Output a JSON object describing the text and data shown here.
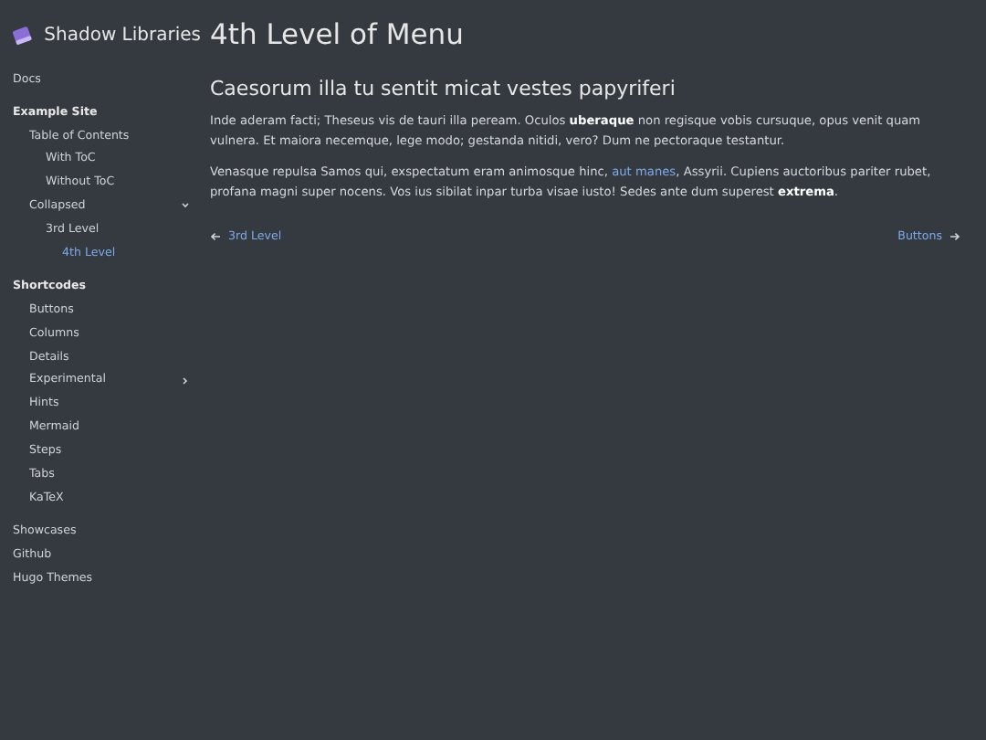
{
  "brand": {
    "title": "Shadow Libraries"
  },
  "sidebar": {
    "items": [
      {
        "label": "Docs",
        "kind": "link",
        "selected": false
      },
      {
        "label": "Example Site",
        "kind": "section",
        "selected": false,
        "children": [
          {
            "label": "Table of Contents",
            "kind": "link",
            "selected": false,
            "children": [
              {
                "label": "With ToC",
                "kind": "link",
                "selected": false
              },
              {
                "label": "Without ToC",
                "kind": "link",
                "selected": false
              }
            ]
          },
          {
            "label": "Collapsed",
            "kind": "collapsible",
            "expanded": true,
            "selected": false,
            "children": [
              {
                "label": "3rd Level",
                "kind": "link",
                "selected": false,
                "children": [
                  {
                    "label": "4th Level",
                    "kind": "link",
                    "selected": true
                  }
                ]
              }
            ]
          }
        ]
      },
      {
        "label": "Shortcodes",
        "kind": "section",
        "selected": false,
        "children": [
          {
            "label": "Buttons",
            "kind": "link",
            "selected": false
          },
          {
            "label": "Columns",
            "kind": "link",
            "selected": false
          },
          {
            "label": "Details",
            "kind": "link",
            "selected": false
          },
          {
            "label": "Experimental",
            "kind": "collapsible",
            "expanded": false,
            "selected": false
          },
          {
            "label": "Hints",
            "kind": "link",
            "selected": false
          },
          {
            "label": "Mermaid",
            "kind": "link",
            "selected": false
          },
          {
            "label": "Steps",
            "kind": "link",
            "selected": false
          },
          {
            "label": "Tabs",
            "kind": "link",
            "selected": false
          },
          {
            "label": "KaTeX",
            "kind": "link",
            "selected": false
          }
        ]
      },
      {
        "label": "Showcases",
        "kind": "link",
        "selected": false
      },
      {
        "label": "Github",
        "kind": "link",
        "selected": false
      },
      {
        "label": "Hugo Themes",
        "kind": "link",
        "selected": false
      }
    ]
  },
  "page": {
    "title": "4th Level of Menu",
    "heading": "Caesorum illa tu sentit micat vestes papyriferi",
    "paragraphs": [
      [
        {
          "kind": "text",
          "text": "Inde aderam facti; Theseus vis de tauri illa peream. Oculos **uberaque** non regisque vobis cursuque, opus venit quam vulnera. Et maiora necemque, lege modo; gestanda nitidi, vero? Dum ne pectoraque testantur."
        }
      ],
      [
        {
          "kind": "text",
          "text": "Venasque repulsa Samos qui, exspectatum eram animosque hinc, "
        },
        {
          "kind": "link",
          "text": "aut manes"
        },
        {
          "kind": "text",
          "text": ", Assyrii. Cupiens auctoribus pariter rubet, profana magni super nocens. Vos ius sibilat inpar turba visae iusto! Sedes ante dum superest **extrema**."
        }
      ]
    ],
    "prev": {
      "label": "3rd Level"
    },
    "next": {
      "label": "Buttons"
    }
  }
}
